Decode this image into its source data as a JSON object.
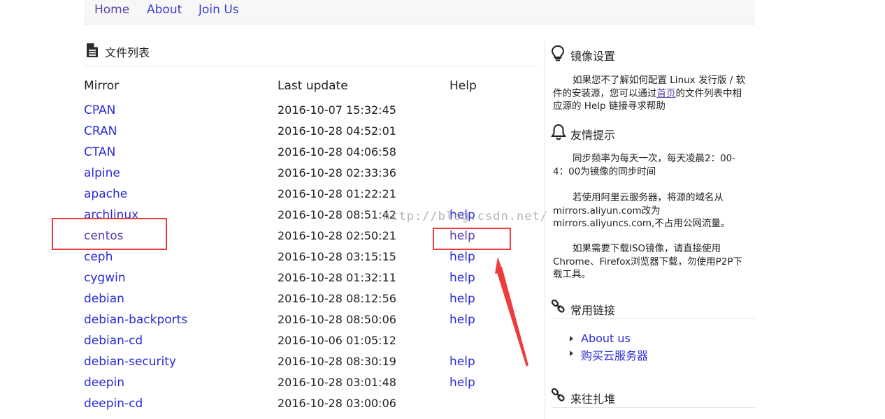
{
  "nav": {
    "items": [
      "Home",
      "About",
      "Join Us"
    ]
  },
  "filelist": {
    "title": "文件列表",
    "columns": [
      "Mirror",
      "Last update",
      "Help"
    ],
    "rows": [
      {
        "name": "CPAN",
        "date": "2016-10-07 15:32:45",
        "help": ""
      },
      {
        "name": "CRAN",
        "date": "2016-10-28 04:52:01",
        "help": ""
      },
      {
        "name": "CTAN",
        "date": "2016-10-28 04:06:58",
        "help": ""
      },
      {
        "name": "alpine",
        "date": "2016-10-28 02:33:36",
        "help": ""
      },
      {
        "name": "apache",
        "date": "2016-10-28 01:22:21",
        "help": ""
      },
      {
        "name": "archlinux",
        "date": "2016-10-28 08:51:42",
        "help": "help"
      },
      {
        "name": "centos",
        "date": "2016-10-28 02:50:21",
        "help": "help"
      },
      {
        "name": "ceph",
        "date": "2016-10-28 03:15:15",
        "help": "help"
      },
      {
        "name": "cygwin",
        "date": "2016-10-28 01:32:11",
        "help": "help"
      },
      {
        "name": "debian",
        "date": "2016-10-28 08:12:56",
        "help": "help"
      },
      {
        "name": "debian-backports",
        "date": "2016-10-28 08:50:06",
        "help": "help"
      },
      {
        "name": "debian-cd",
        "date": "2016-10-06 01:05:12",
        "help": ""
      },
      {
        "name": "debian-security",
        "date": "2016-10-28 08:30:19",
        "help": "help"
      },
      {
        "name": "deepin",
        "date": "2016-10-28 03:01:48",
        "help": "help"
      },
      {
        "name": "deepin-cd",
        "date": "2016-10-28 03:00:06",
        "help": ""
      }
    ]
  },
  "sidebar": {
    "mirror_settings": {
      "title": "镜像设置",
      "text_before": "如果您不了解如何配置 Linux 发行版 / 软件的安装源，您可以通过",
      "link": "首页",
      "text_after": "的文件列表中相应源的 Help 链接寻求帮助"
    },
    "tips": {
      "title": "友情提示",
      "para1": "同步频率为每天一次，每天凌晨2：00-4：00为镜像的同步时间",
      "para2": "若使用阿里云服务器，将源的域名从mirrors.aliyun.com改为mirrors.aliyuncs.com,不占用公网流量。",
      "para3": "如果需要下载ISO镜像，请直接使用Chrome、Firefox浏览器下载，勿使用P2P下载工具。"
    },
    "common_links": {
      "title": "常用链接",
      "items": [
        "About us",
        "购买云服务器"
      ]
    },
    "friend_links": {
      "title": "来往扎堆"
    }
  },
  "watermark": "http://blog.csdn.net/",
  "colors": {
    "link": "#2c2cd6",
    "visited": "#5b3fa6",
    "annotation": "#ee3b3b"
  }
}
